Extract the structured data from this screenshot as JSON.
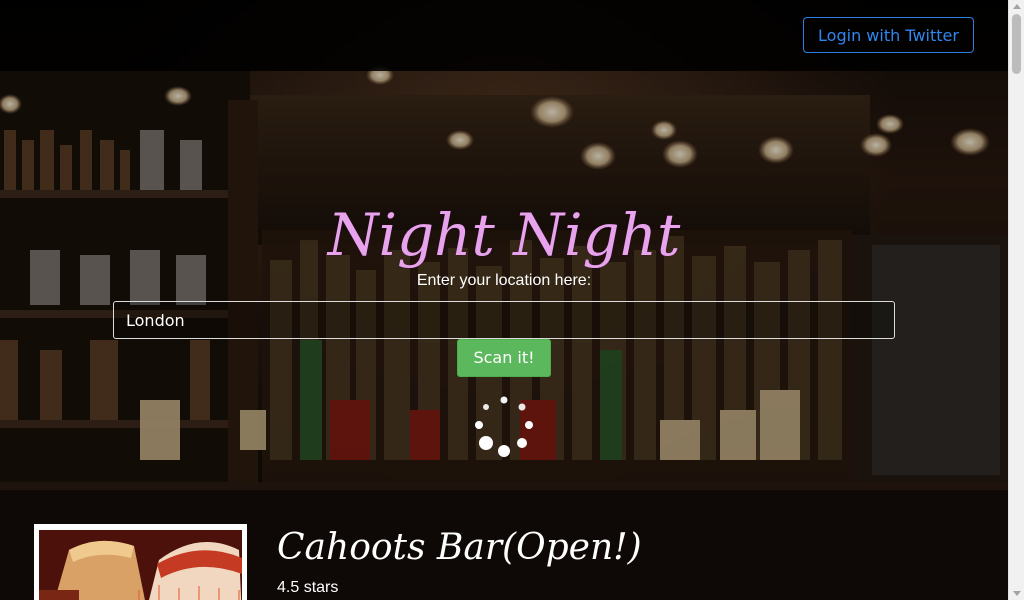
{
  "navbar": {
    "login_label": "Login with Twitter"
  },
  "hero": {
    "title": "Night Night",
    "location_label": "Enter your location here:",
    "location_value": "London",
    "scan_label": "Scan it!",
    "loading": true
  },
  "results": [
    {
      "name": "Cahoots Bar(Open!)",
      "rating": "4.5 stars"
    }
  ],
  "colors": {
    "title": "#e7a3ec",
    "login_accent": "#2f86f0",
    "scan_button": "#5cb85c"
  },
  "icons": {
    "spinner": "loading-spinner-icon"
  }
}
